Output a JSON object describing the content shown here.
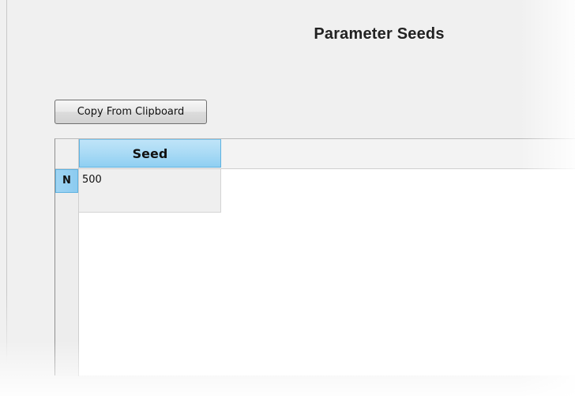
{
  "window": {
    "title": "Parameter Seeds"
  },
  "toolbar": {
    "copy_label": "Copy From Clipboard"
  },
  "grid": {
    "columns": [
      "Seed"
    ],
    "rows": [
      {
        "indicator": "N",
        "seed": "500"
      }
    ]
  },
  "colors": {
    "header_highlight": "#a9daf5",
    "background": "#f0f0f0"
  }
}
